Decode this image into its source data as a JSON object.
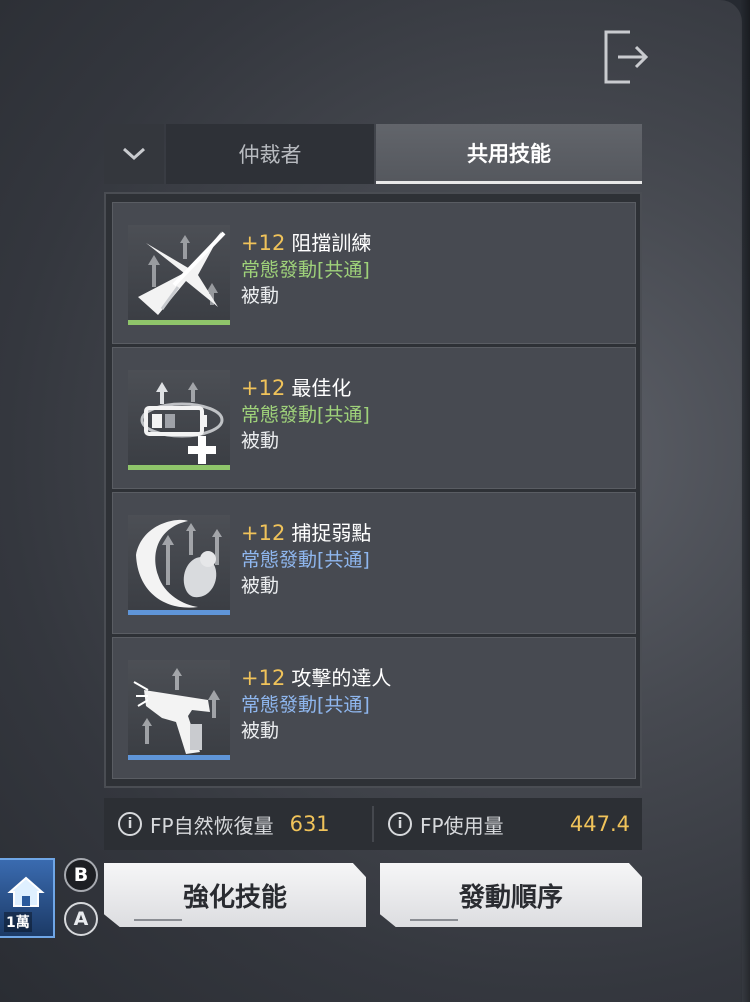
{
  "exit_icon": "exit-icon",
  "tabs": {
    "toggle_icon": "chevron-down-icon",
    "class_tab": "仲裁者",
    "shared_tab": "共用技能"
  },
  "colors": {
    "level": "#f0c35a",
    "green_type": "#9fd27a",
    "blue_type": "#8fb7ef",
    "green_bar": "#8fc56a",
    "blue_bar": "#5f95d8"
  },
  "skills": [
    {
      "level": "+12",
      "name": "阻擋訓練",
      "type": "常態發動[共通]",
      "kind": "被動",
      "type_color": "green",
      "icon": "block-training-icon"
    },
    {
      "level": "+12",
      "name": "最佳化",
      "type": "常態發動[共通]",
      "kind": "被動",
      "type_color": "green",
      "icon": "battery-optimize-icon"
    },
    {
      "level": "+12",
      "name": "捕捉弱點",
      "type": "常態發動[共通]",
      "kind": "被動",
      "type_color": "blue",
      "icon": "weak-point-icon"
    },
    {
      "level": "+12",
      "name": "攻擊的達人",
      "type": "常態發動[共通]",
      "kind": "被動",
      "type_color": "blue",
      "icon": "gun-master-icon"
    }
  ],
  "stats": {
    "recovery_label": "FP自然恢復量",
    "recovery_value": "631",
    "usage_label": "FP使用量",
    "usage_value": "447.4"
  },
  "buttons": {
    "enhance_key": "B",
    "enhance_label": "強化技能",
    "order_key": "A",
    "order_label": "發動順序"
  },
  "thumb": {
    "label": "1萬",
    "icon": "home-icon"
  }
}
